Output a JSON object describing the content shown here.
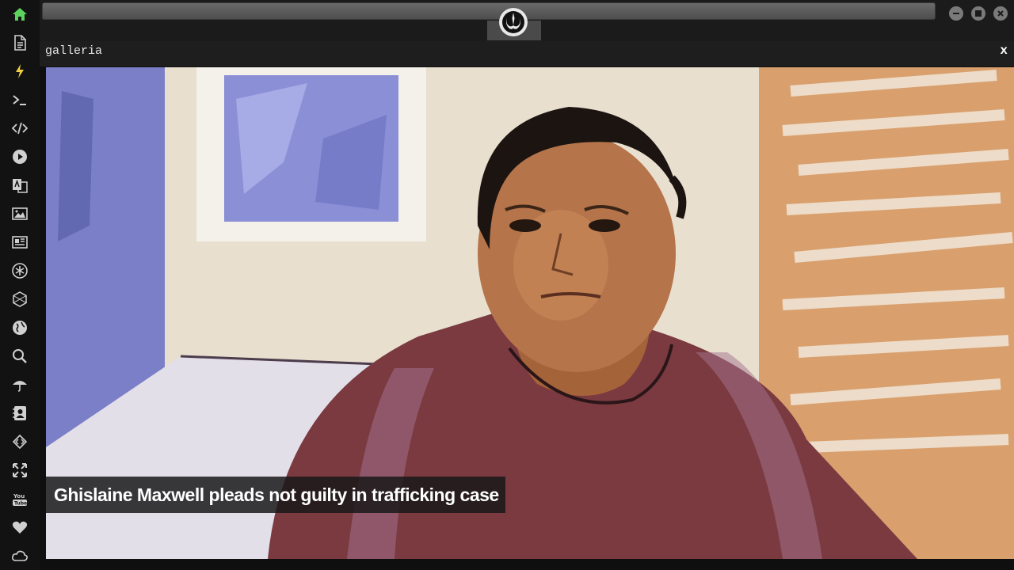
{
  "sidebar": {
    "items": [
      {
        "name": "home-icon",
        "color": "#5cd35c"
      },
      {
        "name": "document-icon",
        "color": "#d0d0d0"
      },
      {
        "name": "lightning-icon",
        "color": "#f0d040"
      },
      {
        "name": "terminal-icon",
        "color": "#d0d0d0"
      },
      {
        "name": "code-icon",
        "color": "#d0d0d0"
      },
      {
        "name": "play-icon",
        "color": "#d0d0d0"
      },
      {
        "name": "translate-icon",
        "color": "#d0d0d0"
      },
      {
        "name": "image-icon",
        "color": "#d0d0d0"
      },
      {
        "name": "news-icon",
        "color": "#d0d0d0"
      },
      {
        "name": "asterisk-icon",
        "color": "#d0d0d0"
      },
      {
        "name": "hexagon-icon",
        "color": "#d0d0d0"
      },
      {
        "name": "globe-icon",
        "color": "#d0d0d0"
      },
      {
        "name": "search-icon",
        "color": "#d0d0d0"
      },
      {
        "name": "umbrella-icon",
        "color": "#d0d0d0"
      },
      {
        "name": "contact-icon",
        "color": "#d0d0d0"
      },
      {
        "name": "diamond-code-icon",
        "color": "#d0d0d0"
      },
      {
        "name": "expand-icon",
        "color": "#d0d0d0"
      },
      {
        "name": "youtube-icon",
        "color": "#d0d0d0"
      },
      {
        "name": "heart-icon",
        "color": "#d0d0d0"
      },
      {
        "name": "cloud-icon",
        "color": "#d0d0d0"
      }
    ]
  },
  "topbar": {
    "logo": "rebel-alliance-icon",
    "window_buttons": [
      "minimize-icon",
      "maximize-icon",
      "close-icon"
    ]
  },
  "gallery": {
    "title": "galleria",
    "close_label": "x",
    "caption": "Ghislaine Maxwell pleads not guilty in trafficking case"
  },
  "colors": {
    "background": "#0f0f0f",
    "accent_home": "#5cd35c",
    "accent_bolt": "#f0d040"
  }
}
